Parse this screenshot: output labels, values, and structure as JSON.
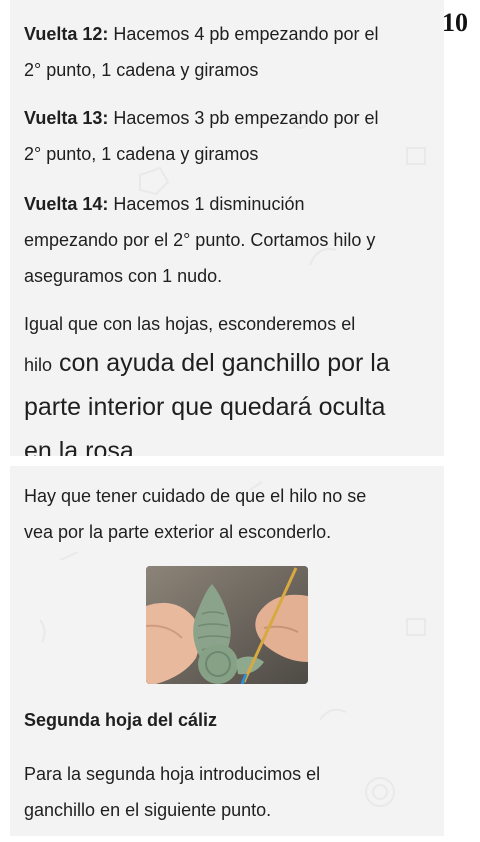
{
  "page": {
    "number": "10"
  },
  "rounds": [
    {
      "label": "Vuelta 12:",
      "line1": " Hacemos 4 pb empezando por el",
      "line2": "2° punto, 1 cadena y giramos"
    },
    {
      "label": "Vuelta 13:",
      "line1": " Hacemos 3 pb empezando por el",
      "line2": "2° punto, 1 cadena y giramos"
    },
    {
      "label": "Vuelta 14:",
      "line1": " Hacemos 1 disminución",
      "line2": "empezando por el 2° punto. Cortamos hilo y",
      "line3": "aseguramos con 1 nudo."
    }
  ],
  "hide_thread": {
    "line1": "Igual que con las hojas, esconderemos el",
    "line2_small": "hilo",
    "line2_large": " con ayuda del ganchillo por la",
    "line3": "parte interior que quedará oculta",
    "line4": "en la rosa"
  },
  "care_note": {
    "line1": "Hay que tener cuidado de que el hilo no se",
    "line2": "vea por la parte exterior al esconderlo."
  },
  "section": {
    "heading": "Segunda hoja del cáliz",
    "line1": "Para la segunda hoja introducimos el",
    "line2": "ganchillo en el siguiente punto."
  },
  "photo": {
    "icon": "crochet-leaf-photo",
    "yarn_color": "#8aa38a",
    "hook_color": "#2f8fd0"
  }
}
